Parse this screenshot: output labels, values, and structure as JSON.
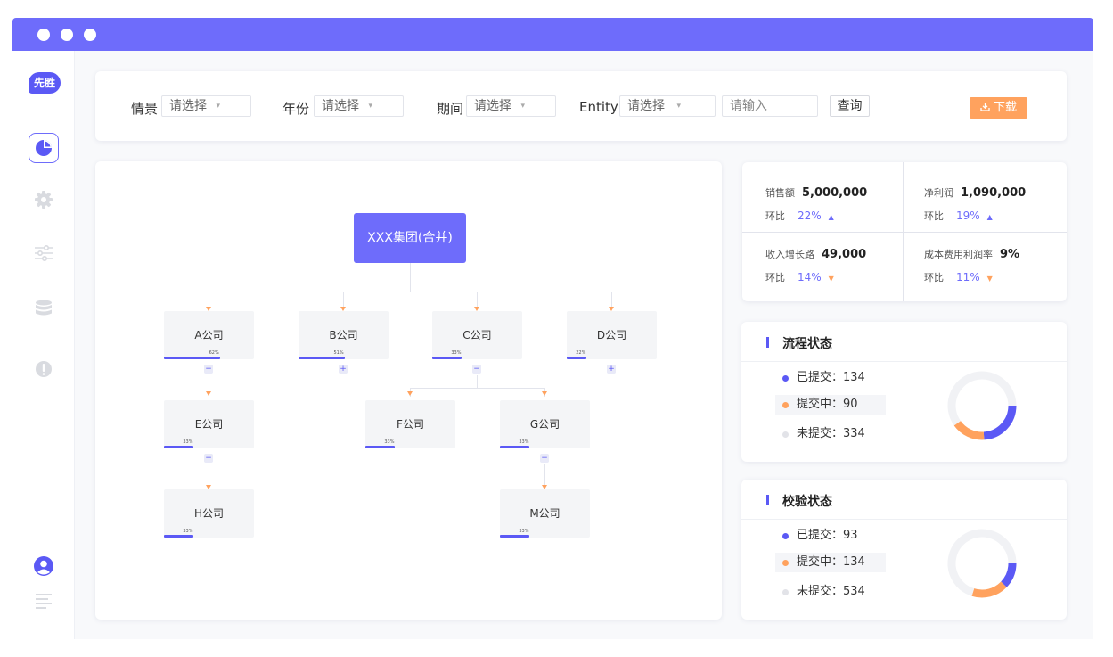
{
  "app": {
    "logo_text": "先胜"
  },
  "filters": {
    "scene_label": "情景",
    "scene_placeholder": "请选择",
    "year_label": "年份",
    "year_placeholder": "请选择",
    "period_label": "期间",
    "period_placeholder": "请选择",
    "entity_label": "Entity",
    "entity_placeholder": "请选择",
    "input_placeholder": "请输入",
    "query_label": "查询",
    "download_label": "下载"
  },
  "tree": {
    "root": "XXX集团(合并)",
    "nodes": [
      {
        "id": "A",
        "label": "A公司",
        "progress": 62,
        "pct_text": "62%",
        "toggle": "−"
      },
      {
        "id": "B",
        "label": "B公司",
        "progress": 51,
        "pct_text": "51%",
        "toggle": "+"
      },
      {
        "id": "C",
        "label": "C公司",
        "progress": 33,
        "pct_text": "33%",
        "toggle": "−"
      },
      {
        "id": "D",
        "label": "D公司",
        "progress": 22,
        "pct_text": "22%",
        "toggle": "+"
      },
      {
        "id": "E",
        "label": "E公司",
        "progress": 33,
        "pct_text": "33%",
        "toggle": "−"
      },
      {
        "id": "F",
        "label": "F公司",
        "progress": 33,
        "pct_text": "33%"
      },
      {
        "id": "G",
        "label": "G公司",
        "progress": 33,
        "pct_text": "33%",
        "toggle": "−"
      },
      {
        "id": "H",
        "label": "H公司",
        "progress": 33,
        "pct_text": "33%"
      },
      {
        "id": "M",
        "label": "M公司",
        "progress": 33,
        "pct_text": "33%"
      }
    ]
  },
  "stats": [
    {
      "label": "销售额",
      "value": "5,000,000",
      "sub_label": "环比",
      "pct": "22%",
      "trend": "▲",
      "trend_color": "#6e6cfb"
    },
    {
      "label": "净利润",
      "value": "1,090,000",
      "sub_label": "环比",
      "pct": "19%",
      "trend": "▲",
      "trend_color": "#6e6cfb"
    },
    {
      "label": "收入增长路",
      "value": "49,000",
      "sub_label": "环比",
      "pct": "14%",
      "trend": "▼",
      "trend_color": "#ffa25e"
    },
    {
      "label": "成本费用利润率",
      "value": "9%",
      "sub_label": "环比",
      "pct": "11%",
      "trend": "▼",
      "trend_color": "#ffa25e"
    }
  ],
  "flow_status": {
    "title": "流程状态",
    "items": [
      {
        "label": "已提交",
        "value": "134",
        "text": "已提交：134",
        "color": "#5b59f5"
      },
      {
        "label": "提交中",
        "value": "90",
        "text": "提交中：90",
        "color": "#ffa25e"
      },
      {
        "label": "未提交",
        "value": "334",
        "text": "未提交：334",
        "color": "#e2e3e8"
      }
    ]
  },
  "check_status": {
    "title": "校验状态",
    "items": [
      {
        "label": "已提交",
        "value": "93",
        "text": "已提交：93",
        "color": "#5b59f5"
      },
      {
        "label": "提交中",
        "value": "134",
        "text": "提交中：134",
        "color": "#ffa25e"
      },
      {
        "label": "未提交",
        "value": "534",
        "text": "未提交：534",
        "color": "#e2e3e8"
      }
    ]
  }
}
